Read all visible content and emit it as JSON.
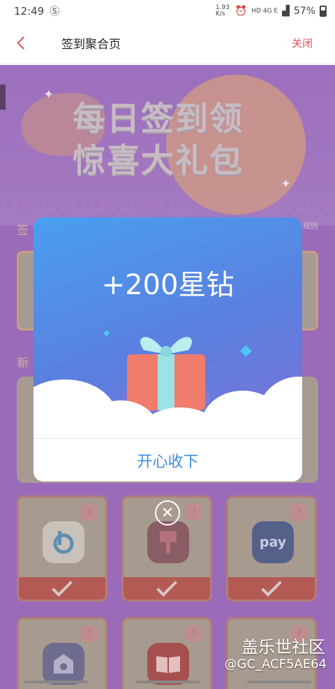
{
  "status": {
    "time": "12:49",
    "speed": "1.93 K/s",
    "network": "HD 4G E",
    "battery": "57%"
  },
  "appbar": {
    "title": "签到聚合页",
    "close_label": "关闭"
  },
  "hero": {
    "line1": "每日签到领",
    "line2": "惊喜大礼包"
  },
  "sections": {
    "sign_label": "签",
    "new_label": "新",
    "rules_label": "规则"
  },
  "dialog": {
    "reward_text": "+200星钻",
    "confirm_label": "开心收下"
  },
  "slots": [
    {
      "app_icon": "bixby-icon",
      "question": "?"
    },
    {
      "app_icon": "theme-brush-icon",
      "question": "?"
    },
    {
      "app_icon": "samsung-pay-icon",
      "app_text": "pay",
      "question": "?"
    },
    {
      "app_icon": "home-shield-icon",
      "question": "?"
    },
    {
      "app_icon": "book-icon",
      "question": "?"
    },
    {
      "app_icon": "app-icon",
      "question": "?"
    }
  ],
  "watermark": {
    "line1": "盖乐世社区",
    "line2": "@GC_ACF5AE64"
  }
}
